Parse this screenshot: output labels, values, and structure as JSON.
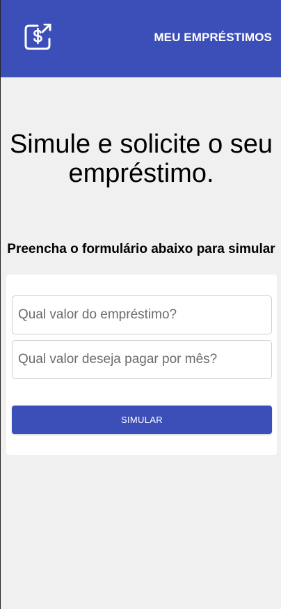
{
  "header": {
    "brand_icon": "money-transfer-icon",
    "title": "MEU EMPRÉSTIMOS",
    "color": "#3c4fb9"
  },
  "hero": {
    "headline": "Simule e solicite o seu empréstimo."
  },
  "form": {
    "instruction": "Preencha o formulário abaixo para simular",
    "amount_field": {
      "placeholder": "Qual valor do empréstimo?",
      "value": ""
    },
    "monthly_field": {
      "placeholder": "Qual valor deseja pagar por mês?",
      "value": ""
    },
    "submit_label": "SIMULAR"
  },
  "colors": {
    "accent": "#3c4fb9",
    "background": "#f0f0f0",
    "card": "#ffffff"
  }
}
